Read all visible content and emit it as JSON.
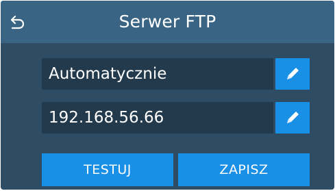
{
  "header": {
    "title": "Serwer FTP",
    "back_icon": "back-arrow-icon"
  },
  "fields": [
    {
      "value": "Automatycznie",
      "edit_icon": "pencil-icon"
    },
    {
      "value": "192.168.56.66",
      "edit_icon": "pencil-icon"
    }
  ],
  "actions": {
    "test_label": "TESTUJ",
    "save_label": "ZAPISZ"
  },
  "colors": {
    "background": "#2e4d64",
    "header": "#3a6483",
    "field": "#223a4c",
    "accent": "#1a8fe6",
    "text": "#ffffff"
  }
}
